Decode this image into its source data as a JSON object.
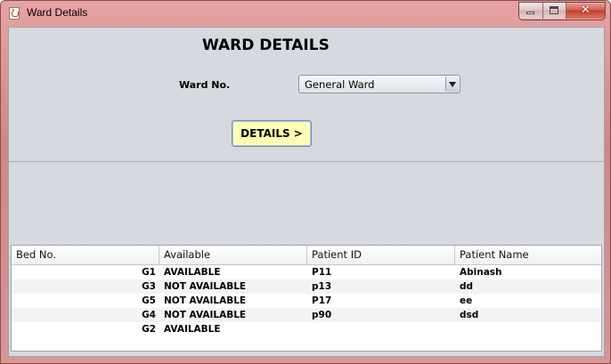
{
  "window": {
    "title": "Ward Details",
    "close_glyph": "✕"
  },
  "form": {
    "heading": "WARD DETAILS",
    "ward_label": "Ward No.",
    "ward_selected": "General Ward",
    "details_button": "DETAILS >"
  },
  "table": {
    "columns": [
      "Bed No.",
      "Available",
      "Patient ID",
      "Patient Name"
    ],
    "rows": [
      {
        "bed": "G1",
        "available": "AVAILABLE",
        "patient_id": "P11",
        "patient_name": "Abinash"
      },
      {
        "bed": "G3",
        "available": "NOT AVAILABLE",
        "patient_id": "p13",
        "patient_name": "dd"
      },
      {
        "bed": "G5",
        "available": "NOT AVAILABLE",
        "patient_id": "P17",
        "patient_name": "ee"
      },
      {
        "bed": "G4",
        "available": "NOT AVAILABLE",
        "patient_id": "p90",
        "patient_name": "dsd"
      },
      {
        "bed": "G2",
        "available": "AVAILABLE",
        "patient_id": "",
        "patient_name": ""
      }
    ]
  },
  "colors": {
    "button_fill": "#fffcb3",
    "panel_bg": "#d6d9df",
    "title_frame": "#d69696",
    "close_button": "#c13f2b"
  }
}
